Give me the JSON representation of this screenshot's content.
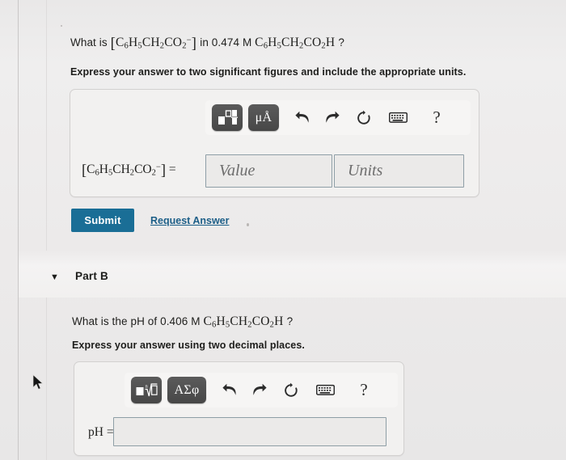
{
  "part_a": {
    "question": {
      "prefix": "What is",
      "species_open": "[",
      "species": "C6H5CH2CO2-",
      "species_close": "]",
      "middle": "in 0.474 M",
      "acid": "C6H5CH2CO2H",
      "suffix": "?",
      "full_text": "What is [C6H5CH2CO2-] in 0.474 M C6H5CH2CO2H?",
      "concentration": "0.474",
      "unit": "M"
    },
    "instruction": "Express your answer to two significant figures and include the appropriate units.",
    "toolbar": {
      "template_button": "template-icon",
      "units_button": "μÅ",
      "undo": "undo-icon",
      "redo": "redo-icon",
      "reset": "reset-icon",
      "keyboard": "keyboard-icon",
      "help": "?"
    },
    "answer_row": {
      "label": "[C6H5CH2CO2-] =",
      "value_placeholder": "Value",
      "value": "",
      "units_placeholder": "Units",
      "units": ""
    },
    "submit_label": "Submit",
    "request_answer_label": "Request Answer"
  },
  "part_b": {
    "header": {
      "caret": "▼",
      "title": "Part B"
    },
    "question": {
      "prefix": "What is the pH of 0.406 M",
      "acid": "C6H5CH2CO2H",
      "suffix": "?",
      "full_text": "What is the pH of 0.406 M C6H5CH2CO2H?",
      "concentration": "0.406",
      "unit": "M"
    },
    "instruction": "Express your answer using two decimal places.",
    "toolbar": {
      "template_button": "sqrt-template-icon",
      "greek_button": "ΑΣφ",
      "undo": "undo-icon",
      "redo": "redo-icon",
      "reset": "reset-icon",
      "keyboard": "keyboard-icon",
      "help": "?"
    },
    "answer_row": {
      "label": "pH =",
      "value": "",
      "value_placeholder": ""
    }
  },
  "colors": {
    "submit_bg": "#1a6e96",
    "link": "#1c5f88",
    "toolbar_button": "#4a4a4a",
    "page_bg": "#eceaea",
    "card_bg": "#f2f1f0",
    "input_border": "#8e9ea6"
  }
}
